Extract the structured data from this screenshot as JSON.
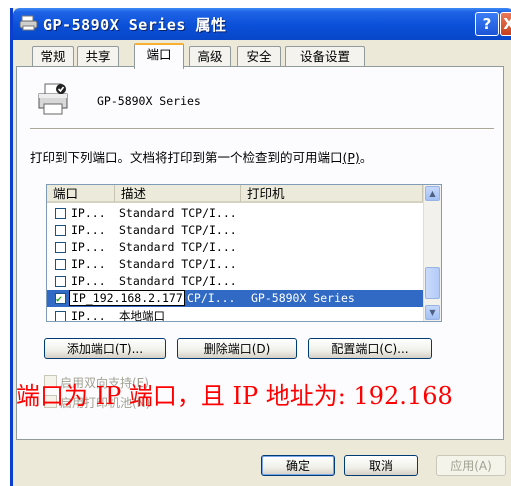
{
  "window": {
    "title": "GP-5890X Series 属性"
  },
  "titlebar_buttons": {
    "help": "?",
    "close": "X"
  },
  "tabs": [
    {
      "label": "常规"
    },
    {
      "label": "共享"
    },
    {
      "label": "端口"
    },
    {
      "label": "高级"
    },
    {
      "label": "安全"
    },
    {
      "label": "设备设置"
    }
  ],
  "active_tab": "端口",
  "printer": {
    "name": "GP-5890X Series"
  },
  "instruction": {
    "text": "打印到下列端口。文档将打印到第一个检查到的可用端口",
    "accel": "(P)",
    "end": "。"
  },
  "ports_table": {
    "headers": [
      "端口",
      "描述",
      "打印机"
    ],
    "rows": [
      {
        "checked": false,
        "port": "IP...",
        "desc": "Standard TCP/I...",
        "printer": ""
      },
      {
        "checked": false,
        "port": "IP...",
        "desc": "Standard TCP/I...",
        "printer": ""
      },
      {
        "checked": false,
        "port": "IP...",
        "desc": "Standard TCP/I...",
        "printer": ""
      },
      {
        "checked": false,
        "port": "IP...",
        "desc": "Standard TCP/I...",
        "printer": ""
      },
      {
        "checked": false,
        "port": "IP...",
        "desc": "Standard TCP/I...",
        "printer": ""
      }
    ],
    "selected_row": {
      "checked": true,
      "port_edit": "IP_192.168.2.177",
      "desc_tail": "CP/I...",
      "printer": "GP-5890X Series"
    },
    "partial_row": {
      "port": "IP...",
      "desc": "本地端口"
    }
  },
  "buttons": {
    "add_port": "添加端口(T)...",
    "delete_port": "删除端口(D)",
    "config_port": "配置端口(C)..."
  },
  "checkboxes": {
    "bidirectional": "启用双向支持(E)",
    "pool": "启用打印机池(N)"
  },
  "overlay_annotation": "端口为 IP 端口，且 IP 地址为: 192.168",
  "dialog_buttons": {
    "ok": "确定",
    "cancel": "取消",
    "apply": "应用(A)"
  },
  "colors": {
    "title_blue": "#0a50d8",
    "selection": "#316ac5",
    "annotation_red": "#ff0000"
  }
}
